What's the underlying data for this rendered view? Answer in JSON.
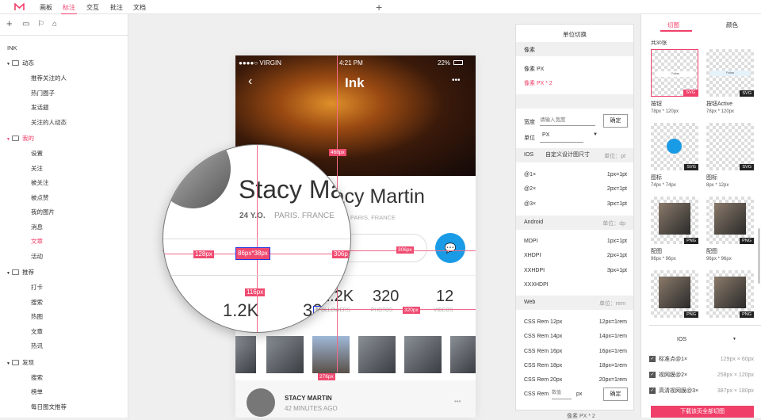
{
  "topbar": {
    "tabs": [
      "画板",
      "标注",
      "交互",
      "批注",
      "文档"
    ],
    "active": "标注"
  },
  "sidebar": {
    "root": "INK",
    "groups": [
      {
        "label": "动态",
        "items": [
          "推荐关注的人",
          "热门圈子",
          "发话题",
          "关注的人动态"
        ]
      },
      {
        "label": "我的",
        "items": [
          "设置",
          "关注",
          "被关注",
          "被点赞",
          "我的图片",
          "消息",
          "文章",
          "活动"
        ]
      },
      {
        "label": "推荐",
        "items": [
          "打卡",
          "搜索",
          "热图",
          "文章",
          "热讯"
        ]
      },
      {
        "label": "发现",
        "items": [
          "搜索",
          "榜单",
          "每日图文推荐"
        ]
      }
    ]
  },
  "phone": {
    "carrier": "●●●●○ VIRGIN",
    "time": "4:21 PM",
    "battery": "22%",
    "title": "Ink",
    "name": "Stacy Martin",
    "age": "24 Y.O.",
    "location": "PARIS, FRANCE",
    "stats": [
      {
        "value": "1.2K",
        "label": "FOLLOWERS"
      },
      {
        "value": "320",
        "label": "PHOTOS"
      },
      {
        "value": "12",
        "label": "VIDEOS"
      }
    ],
    "post_name": "STACY MARTIN",
    "post_time": "42 MINUTES AGO"
  },
  "magnifier": {
    "name": "Stacy Ma",
    "age": "24 Y.O.",
    "location": "PARIS. FRANCE",
    "stat": "1.2K",
    "stat2": "32",
    "label": "LOWERS"
  },
  "measures": {
    "m468": "468px",
    "m128": "128px",
    "size": "86px*38px",
    "m306": "306px",
    "m306b": "306p",
    "m116": "116px",
    "m320": "320px",
    "m276": "276px"
  },
  "panel": {
    "title": "单位切换",
    "pixel_header": "像素",
    "pixel_px": "像素 PX",
    "pixel_px2": "像素 PX * 2",
    "width_label": "宽度",
    "width_placeholder": "请输入宽度",
    "confirm": "确定",
    "unit_label": "单位",
    "unit_value": "PX",
    "custom": "自定义设计图尺寸",
    "ios": {
      "label": "IOS",
      "unit": "单位：pt",
      "rows": [
        [
          "@1×",
          "1px=1pt"
        ],
        [
          "@2×",
          "2px=1pt"
        ],
        [
          "@3×",
          "3px=1pt"
        ]
      ]
    },
    "android": {
      "label": "Android",
      "unit": "单位：dp",
      "rows": [
        [
          "MDPI",
          "1px=1pt"
        ],
        [
          "XHDPI",
          "2px=1pt"
        ],
        [
          "XXHDPI",
          "3px=1pt"
        ],
        [
          "XXXHDPI",
          ""
        ]
      ]
    },
    "web": {
      "label": "Web",
      "unit": "单位：rem",
      "rows": [
        [
          "CSS Rem 12px",
          "12px=1rem"
        ],
        [
          "CSS Rem 14px",
          "14px=1rem"
        ],
        [
          "CSS Rem 16px",
          "16px=1rem"
        ],
        [
          "CSS Rem 18px",
          "18px=1rem"
        ],
        [
          "CSS Rem 20px",
          "20px=1rem"
        ]
      ]
    },
    "custom_rem": "CSS Rem",
    "rem_placeholder": "数值",
    "rem_unit": "px",
    "behind": "像素 PX * 2"
  },
  "right": {
    "tabs": [
      "切图",
      "颜色"
    ],
    "count": "共30张",
    "cards": [
      {
        "label": "按钮",
        "size": "78px * 120px",
        "type": "SVG"
      },
      {
        "label": "按钮Active",
        "size": "78px * 120px",
        "type": "SVG"
      },
      {
        "label": "图标",
        "size": "74px * 74px",
        "type": "SVG"
      },
      {
        "label": "图标",
        "size": "8px * 12px",
        "type": "SVG"
      },
      {
        "label": "配图",
        "size": "96px * 96px",
        "type": "PNG"
      },
      {
        "label": "配图",
        "size": "96px * 96px",
        "type": "PNG"
      },
      {
        "label": "",
        "size": "",
        "type": "PNG"
      },
      {
        "label": "",
        "size": "",
        "type": "PNG"
      }
    ],
    "follow": "Follow",
    "platform": "IOS",
    "exports": [
      [
        "标准点@1×",
        "129px × 60px"
      ],
      [
        "视网膜@2×",
        "258px × 120px"
      ],
      [
        "高清视网膜@3×",
        "387px × 180px"
      ]
    ],
    "download": "下载该页全部切图"
  },
  "colors": {
    "accent": "#f0406a",
    "blue": "#1a9be6"
  }
}
